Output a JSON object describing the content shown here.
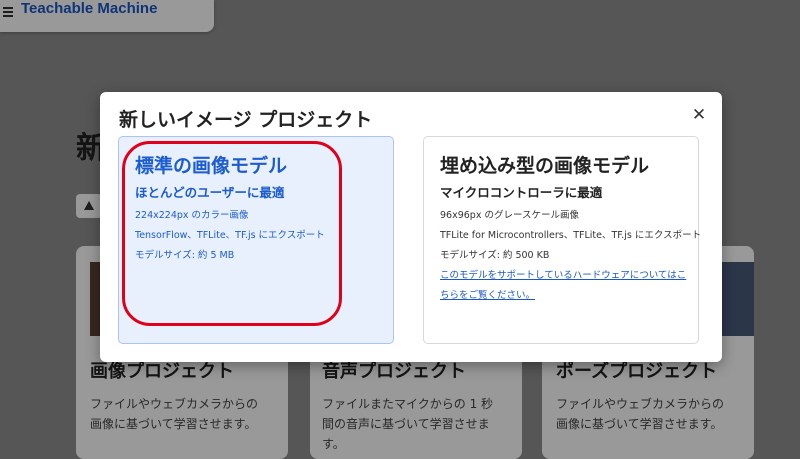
{
  "app": {
    "title": "Teachable Machine"
  },
  "background": {
    "heading_fragment": "新",
    "cards": [
      {
        "title": "画像プロジェクト",
        "description": "ファイルやウェブカメラからの画像に基づいて学習させます。"
      },
      {
        "title": "音声プロジェクト",
        "description": "ファイルまたマイクからの 1 秒間の音声に基づいて学習させます。"
      },
      {
        "title": "ポーズプロジェクト",
        "description": "ファイルやウェブカメラからの画像に基づいて学習させます。"
      }
    ]
  },
  "modal": {
    "title": "新しいイメージ プロジェクト",
    "close_icon": "close-icon",
    "options": [
      {
        "title": "標準の画像モデル",
        "subtitle": "ほとんどのユーザーに最適",
        "lines": [
          "224x224px のカラー画像",
          "TensorFlow、TFLite、TF.js にエクスポート",
          "モデルサイズ: 約 5 MB"
        ],
        "selected": true
      },
      {
        "title": "埋め込み型の画像モデル",
        "subtitle": "マイクロコントローラに最適",
        "lines": [
          "96x96px のグレースケール画像",
          "TFLite for Microcontrollers、TFLite、TF.js にエクスポート",
          "モデルサイズ: 約 500 KB"
        ],
        "link": "このモデルをサポートしているハードウェアについてはこちらをご覧ください。",
        "selected": false
      }
    ]
  },
  "colors": {
    "accent": "#1b5cd0",
    "selected_bg": "#e9f0fd",
    "annotation": "#e0001a"
  }
}
